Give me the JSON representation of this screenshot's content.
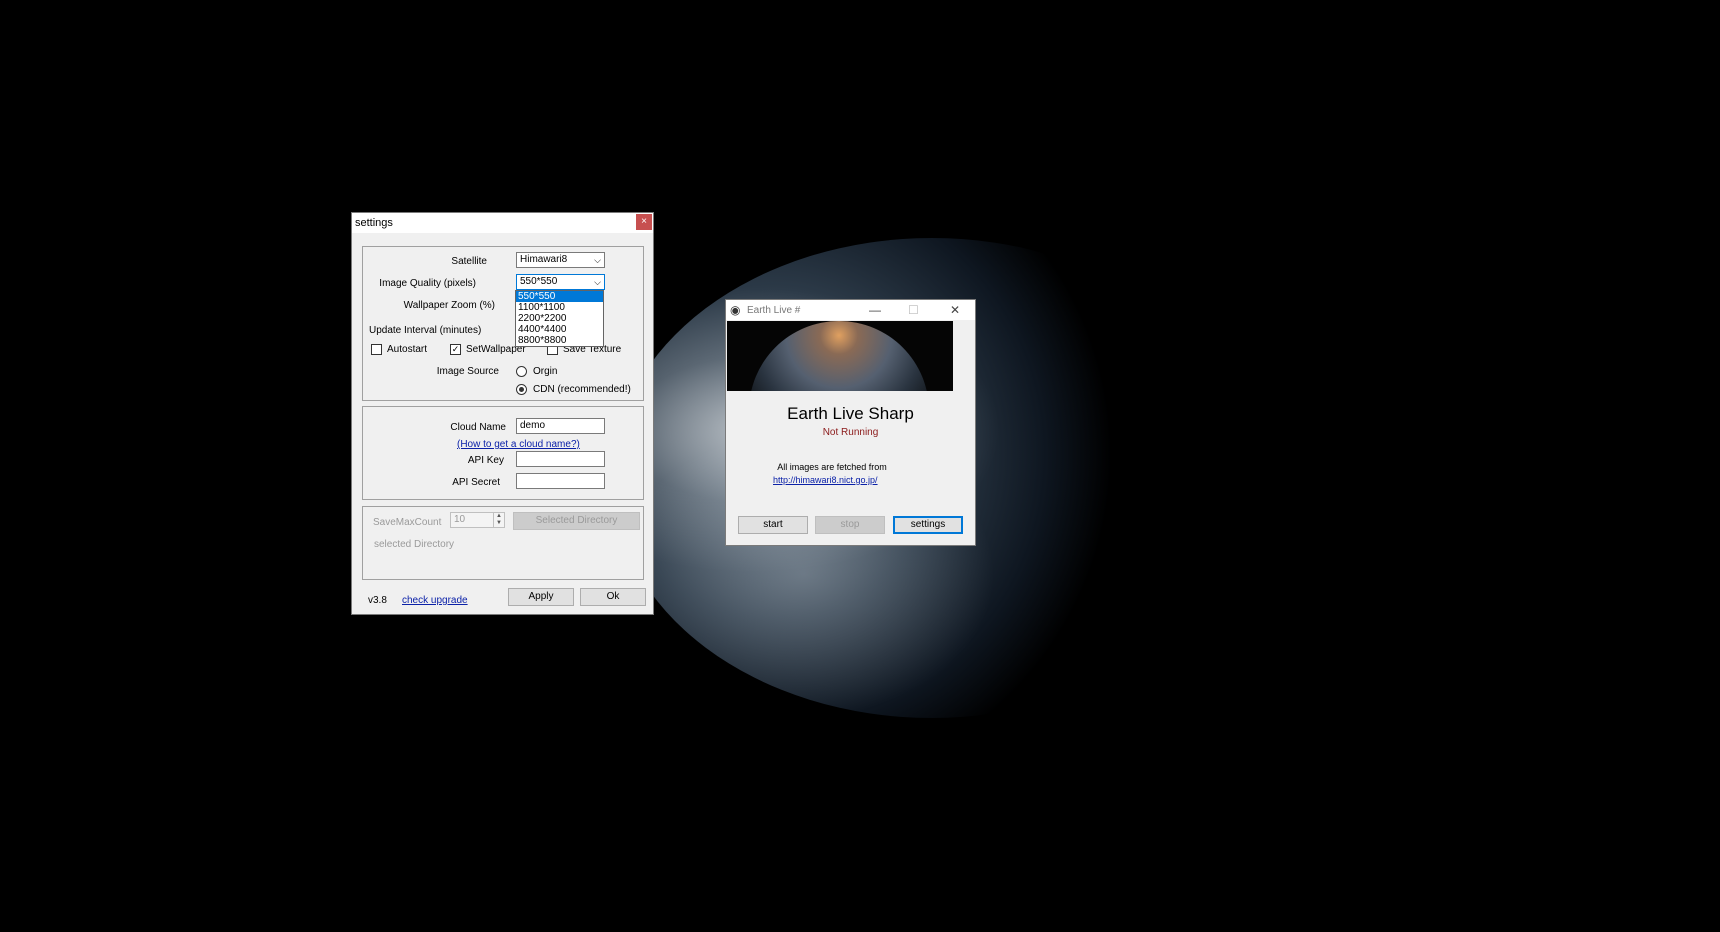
{
  "settings": {
    "title": "settings",
    "close_glyph": "×",
    "satellite_label": "Satellite",
    "satellite_value": "Himawari8",
    "quality_label": "Image Quality (pixels)",
    "quality_value": "550*550",
    "quality_options": [
      "550*550",
      "1100*1100",
      "2200*2200",
      "4400*4400",
      "8800*8800"
    ],
    "zoom_label": "Wallpaper Zoom (%)",
    "interval_label": "Update Interval (minutes)",
    "autostart_label": "Autostart",
    "setwallpaper_label": "SetWallpaper",
    "savetexture_label": "Save Texture",
    "image_source_label": "Image Source",
    "source_origin": "Orgin",
    "source_cdn": "CDN (recommended!)",
    "cloud_name_label": "Cloud Name",
    "cloud_name_value": "demo",
    "cloud_help_link": "(How to get a cloud name?)",
    "api_key_label": "API Key",
    "api_secret_label": "API Secret",
    "savemax_label": "SaveMaxCount",
    "savemax_value": "10",
    "selected_dir_button": "Selected Directory",
    "selected_dir_text": "selected Directory",
    "version": "v3.8",
    "check_upgrade": "check upgrade",
    "apply": "Apply",
    "ok": "Ok"
  },
  "main": {
    "title": "Earth Live #",
    "app_name": "Earth Live Sharp",
    "status": "Not Running",
    "status_color": "#8b1a1a",
    "fetched_text": "All images are fetched from",
    "source_url": "http://himawari8.nict.go.jp/",
    "start": "start",
    "stop": "stop",
    "settings": "settings",
    "minimize_glyph": "—",
    "maximize_glyph": "☐",
    "close_glyph": "✕"
  }
}
